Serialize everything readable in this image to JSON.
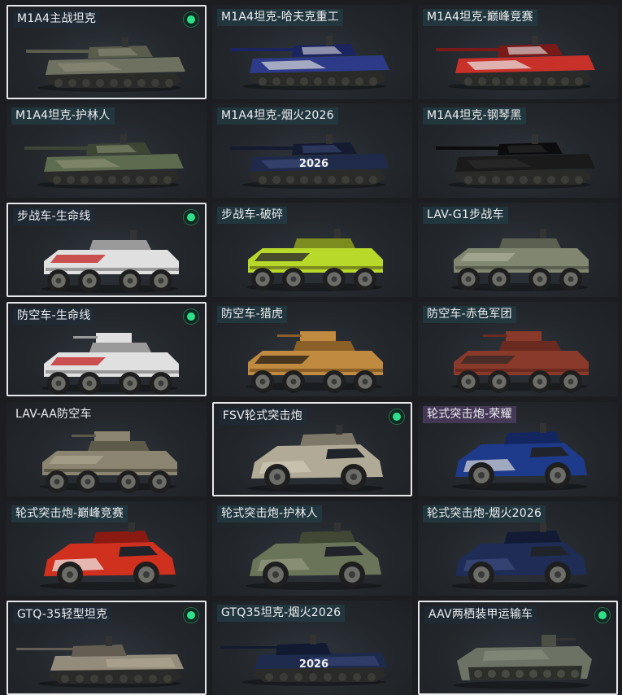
{
  "tiles": [
    {
      "label": "M1A4主战坦克",
      "kind": "tank",
      "selected": true,
      "owned": true,
      "colors": [
        "#6e7060",
        "#8a8a76",
        "#5a5c4c"
      ]
    },
    {
      "label": "M1A4坦克-哈夫克重工",
      "kind": "tank",
      "selected": false,
      "owned": false,
      "colors": [
        "#2c3a88",
        "#d8d8dc",
        "#1a2460"
      ]
    },
    {
      "label": "M1A4坦克-巅峰竞赛",
      "kind": "tank",
      "selected": false,
      "owned": false,
      "colors": [
        "#c8302a",
        "#e8e8e8",
        "#7a1a18"
      ]
    },
    {
      "label": "M1A4坦克-护林人",
      "kind": "tank",
      "selected": false,
      "owned": false,
      "colors": [
        "#5d6b4e",
        "#8b8f74",
        "#3d4634"
      ]
    },
    {
      "label": "M1A4坦克-烟火2026",
      "kind": "tank",
      "selected": false,
      "owned": false,
      "colors": [
        "#1f2a4a",
        "#3a4a78",
        "#141a30"
      ],
      "decal": "2026"
    },
    {
      "label": "M1A4坦克-钢琴黑",
      "kind": "tank",
      "selected": false,
      "owned": false,
      "colors": [
        "#1a1a1a",
        "#2c2c2c",
        "#0c0c0c"
      ]
    },
    {
      "label": "步战车-生命线",
      "kind": "ifv",
      "selected": true,
      "owned": true,
      "colors": [
        "#e0e0e0",
        "#c42a2a",
        "#9a9a9a"
      ]
    },
    {
      "label": "步战车-破碎",
      "kind": "ifv",
      "selected": false,
      "owned": false,
      "colors": [
        "#b8d82a",
        "#2a2a2a",
        "#7c8c1e"
      ]
    },
    {
      "label": "LAV-G1步战车",
      "kind": "ifv",
      "selected": false,
      "owned": false,
      "colors": [
        "#808670",
        "#a8ab96",
        "#5c6050"
      ]
    },
    {
      "label": "防空车-生命线",
      "kind": "aa",
      "selected": true,
      "owned": true,
      "colors": [
        "#e0e0e0",
        "#c42a2a",
        "#9a9a9a"
      ]
    },
    {
      "label": "防空车-猎虎",
      "kind": "aa",
      "selected": false,
      "owned": false,
      "colors": [
        "#c08a40",
        "#2a2218",
        "#8a6028"
      ]
    },
    {
      "label": "防空车-赤色军团",
      "kind": "aa",
      "selected": false,
      "owned": false,
      "colors": [
        "#8a3a2a",
        "#3a2a26",
        "#6a2a20"
      ]
    },
    {
      "label": "LAV-AA防空车",
      "kind": "aa",
      "selected": false,
      "owned": false,
      "colors": [
        "#8a8470",
        "#a8a28c",
        "#5e5a4a"
      ],
      "nolabelbg": true
    },
    {
      "label": "FSV轮式突击炮",
      "kind": "fsv",
      "selected": true,
      "owned": true,
      "colors": [
        "#b0aa96",
        "#d0cab6",
        "#7e7868"
      ]
    },
    {
      "label": "轮式突击炮-荣耀",
      "kind": "fsv",
      "selected": false,
      "owned": false,
      "colors": [
        "#1e3a8a",
        "#d8d8d8",
        "#142660"
      ],
      "highlight": true
    },
    {
      "label": "轮式突击炮-巅峰竞赛",
      "kind": "fsv",
      "selected": false,
      "owned": false,
      "colors": [
        "#d0301e",
        "#f0f0f0",
        "#8a1a12"
      ]
    },
    {
      "label": "轮式突击炮-护林人",
      "kind": "fsv",
      "selected": false,
      "owned": false,
      "colors": [
        "#6a7458",
        "#949a80",
        "#404834"
      ]
    },
    {
      "label": "轮式突击炮-烟火2026",
      "kind": "fsv",
      "selected": false,
      "owned": false,
      "colors": [
        "#1e2c56",
        "#3c4c7e",
        "#121a36"
      ]
    },
    {
      "label": "GTQ-35轻型坦克",
      "kind": "light",
      "selected": true,
      "owned": true,
      "colors": [
        "#948c7a",
        "#b4ac98",
        "#645e52"
      ]
    },
    {
      "label": "GTQ35坦克-烟火2026",
      "kind": "light",
      "selected": false,
      "owned": false,
      "colors": [
        "#1e2a4c",
        "#3a4a7c",
        "#121a32"
      ],
      "decal": "2026"
    },
    {
      "label": "AAV两栖装甲运输车",
      "kind": "aav",
      "selected": true,
      "owned": true,
      "colors": [
        "#6c7264",
        "#8c9280",
        "#4c5044"
      ]
    }
  ]
}
